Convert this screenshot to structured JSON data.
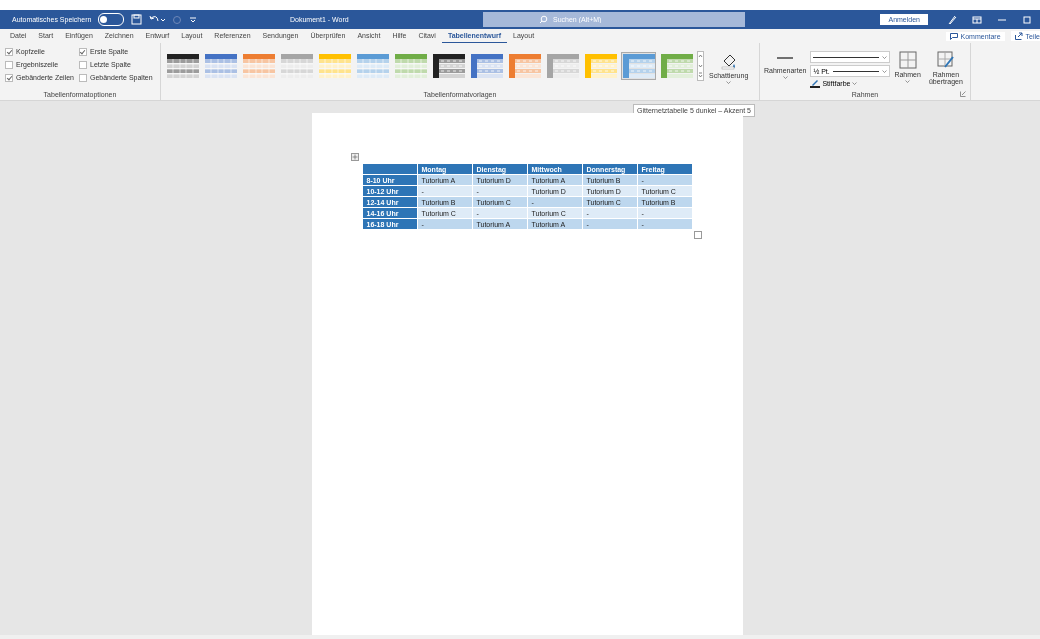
{
  "title_bar": {
    "autosave_label": "Automatisches Speichern",
    "autosave_on": false,
    "title": "Dokument1  -  Word",
    "search": {
      "placeholder": "Suchen (Alt+M)"
    },
    "signin": "Anmelden"
  },
  "ribbon_tabs": [
    {
      "label": "Datei",
      "selected": false
    },
    {
      "label": "Start",
      "selected": false
    },
    {
      "label": "Einfügen",
      "selected": false
    },
    {
      "label": "Zeichnen",
      "selected": false
    },
    {
      "label": "Entwurf",
      "selected": false
    },
    {
      "label": "Layout",
      "selected": false
    },
    {
      "label": "Referenzen",
      "selected": false
    },
    {
      "label": "Sendungen",
      "selected": false
    },
    {
      "label": "Überprüfen",
      "selected": false
    },
    {
      "label": "Ansicht",
      "selected": false
    },
    {
      "label": "Hilfe",
      "selected": false
    },
    {
      "label": "Citavi",
      "selected": false
    },
    {
      "label": "Tabellenentwurf",
      "selected": true
    },
    {
      "label": "Layout",
      "selected": false
    }
  ],
  "ribbon_right": {
    "comments": "Kommentare",
    "share": "Teile"
  },
  "options_group": {
    "label": "Tabellenformatoptionen",
    "options": [
      {
        "label": "Kopfzeile",
        "checked": true
      },
      {
        "label": "Ergebniszeile",
        "checked": false
      },
      {
        "label": "Gebänderte Zeilen",
        "checked": true
      },
      {
        "label": "Erste Spalte",
        "checked": true
      },
      {
        "label": "Letzte Spalte",
        "checked": false
      },
      {
        "label": "Gebänderte Spalten",
        "checked": false
      }
    ]
  },
  "styles_group": {
    "label": "Tabellenformatvorlagen",
    "shading": "Schattierung",
    "styles": [
      {
        "kind": "light",
        "color": "#222222",
        "selected": false
      },
      {
        "kind": "light",
        "color": "#4472c4",
        "selected": false
      },
      {
        "kind": "light",
        "color": "#ed7d31",
        "selected": false
      },
      {
        "kind": "light",
        "color": "#a5a5a5",
        "selected": false
      },
      {
        "kind": "light",
        "color": "#ffc000",
        "selected": false
      },
      {
        "kind": "light",
        "color": "#5b9bd5",
        "selected": false
      },
      {
        "kind": "light",
        "color": "#70ad47",
        "selected": false
      },
      {
        "kind": "dark",
        "color": "#222222",
        "selected": false
      },
      {
        "kind": "dark",
        "color": "#4472c4",
        "selected": false
      },
      {
        "kind": "dark",
        "color": "#ed7d31",
        "selected": false
      },
      {
        "kind": "dark",
        "color": "#a5a5a5",
        "selected": false
      },
      {
        "kind": "dark",
        "color": "#ffc000",
        "selected": false
      },
      {
        "kind": "dark",
        "color": "#5b9bd5",
        "selected": true
      },
      {
        "kind": "dark",
        "color": "#70ad47",
        "selected": false
      }
    ]
  },
  "borders_group": {
    "label": "Rahmen",
    "border_styles": "Rahmenarten",
    "pen_weight": "½ Pt.",
    "pen_color": "Stiftfarbe",
    "borders": "Rahmen",
    "border_painter": "Rahmen übertragen"
  },
  "tooltip": "Gitternetztabelle 5 dunkel – Akzent 5",
  "document_table": {
    "columns": [
      "",
      "Montag",
      "Dienstag",
      "Mittwoch",
      "Donnerstag",
      "Freitag"
    ],
    "rows": [
      [
        "8-10 Uhr",
        "Tutorium A",
        "Tutorium D",
        "Tutorium A",
        "Tutorium B",
        "-"
      ],
      [
        "10-12 Uhr",
        "-",
        "-",
        "Tutorium D",
        "Tutorium D",
        "Tutorium C"
      ],
      [
        "12-14 Uhr",
        "Tutorium B",
        "Tutorium C",
        "-",
        "Tutorium C",
        "Tutorium B"
      ],
      [
        "14-16 Uhr",
        "Tutorium C",
        "-",
        "Tutorium C",
        "-",
        "-"
      ],
      [
        "16-18 Uhr",
        "-",
        "Tutorium A",
        "Tutorium A",
        "-",
        "-"
      ]
    ]
  }
}
